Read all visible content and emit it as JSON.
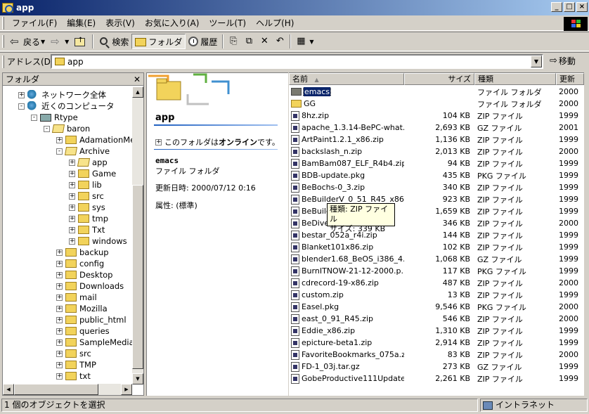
{
  "window": {
    "title": "app"
  },
  "menu": [
    "ファイル(F)",
    "編集(E)",
    "表示(V)",
    "お気に入り(A)",
    "ツール(T)",
    "ヘルプ(H)"
  ],
  "toolbar": {
    "back": "戻る",
    "search": "検索",
    "folders": "フォルダ",
    "history": "履歴"
  },
  "address": {
    "label": "アドレス(D)",
    "value": "app",
    "go": "移動"
  },
  "folder_pane": {
    "title": "フォルダ",
    "tree": [
      {
        "label": "ネットワーク全体",
        "depth": 1,
        "icon": "network-icon",
        "exp": "+"
      },
      {
        "label": "近くのコンピュータ",
        "depth": 1,
        "icon": "network-icon",
        "exp": "-"
      },
      {
        "label": "Rtype",
        "depth": 2,
        "icon": "computer-icon",
        "exp": "-"
      },
      {
        "label": "baron",
        "depth": 3,
        "icon": "folder-open-icon",
        "exp": "-"
      },
      {
        "label": "AdamationMe",
        "depth": 4,
        "icon": "folder-icon",
        "exp": "+"
      },
      {
        "label": "Archive",
        "depth": 4,
        "icon": "folder-open-icon",
        "exp": "-"
      },
      {
        "label": "app",
        "depth": 5,
        "icon": "folder-open-icon",
        "exp": "+"
      },
      {
        "label": "Game",
        "depth": 5,
        "icon": "folder-icon",
        "exp": "+"
      },
      {
        "label": "lib",
        "depth": 5,
        "icon": "folder-icon",
        "exp": "+"
      },
      {
        "label": "src",
        "depth": 5,
        "icon": "folder-icon",
        "exp": "+"
      },
      {
        "label": "sys",
        "depth": 5,
        "icon": "folder-icon",
        "exp": "+"
      },
      {
        "label": "tmp",
        "depth": 5,
        "icon": "folder-icon",
        "exp": "+"
      },
      {
        "label": "Txt",
        "depth": 5,
        "icon": "folder-icon",
        "exp": "+"
      },
      {
        "label": "windows",
        "depth": 5,
        "icon": "folder-icon",
        "exp": "+"
      },
      {
        "label": "backup",
        "depth": 4,
        "icon": "folder-icon",
        "exp": "+"
      },
      {
        "label": "config",
        "depth": 4,
        "icon": "folder-icon",
        "exp": "+"
      },
      {
        "label": "Desktop",
        "depth": 4,
        "icon": "folder-icon",
        "exp": "+"
      },
      {
        "label": "Downloads",
        "depth": 4,
        "icon": "folder-icon",
        "exp": "+"
      },
      {
        "label": "mail",
        "depth": 4,
        "icon": "folder-icon",
        "exp": "+"
      },
      {
        "label": "Mozilla",
        "depth": 4,
        "icon": "folder-icon",
        "exp": "+"
      },
      {
        "label": "public_html",
        "depth": 4,
        "icon": "folder-icon",
        "exp": "+"
      },
      {
        "label": "queries",
        "depth": 4,
        "icon": "folder-icon",
        "exp": "+"
      },
      {
        "label": "SampleMedia",
        "depth": 4,
        "icon": "folder-icon",
        "exp": "+"
      },
      {
        "label": "src",
        "depth": 4,
        "icon": "folder-icon",
        "exp": "+"
      },
      {
        "label": "TMP",
        "depth": 4,
        "icon": "folder-icon",
        "exp": "+"
      },
      {
        "label": "txt",
        "depth": 4,
        "icon": "folder-icon",
        "exp": "+"
      }
    ]
  },
  "webview": {
    "folder_name": "app",
    "online_pre": "このフォルダは",
    "online_bold": "オンライン",
    "online_post": "です。",
    "item_name": "emacs",
    "item_type": "ファイル フォルダ",
    "modified": "更新日時: 2000/07/12 0:16",
    "attributes": "属性: (標準)"
  },
  "list": {
    "columns": {
      "name": "名前",
      "size": "サイズ",
      "type": "種類",
      "modified": "更新"
    },
    "rows": [
      {
        "name": "emacs",
        "size": "",
        "type": "ファイル フォルダ",
        "mod": "2000",
        "kind": "folder-dark",
        "selected": true
      },
      {
        "name": "GG",
        "size": "",
        "type": "ファイル フォルダ",
        "mod": "2000",
        "kind": "folder"
      },
      {
        "name": "8hz.zip",
        "size": "104 KB",
        "type": "ZIP ファイル",
        "mod": "1999",
        "kind": "file"
      },
      {
        "name": "apache_1.3.14-BePC-what...",
        "size": "2,693 KB",
        "type": "GZ ファイル",
        "mod": "2001",
        "kind": "file"
      },
      {
        "name": "ArtPaint1.2.1_x86.zip",
        "size": "1,136 KB",
        "type": "ZIP ファイル",
        "mod": "1999",
        "kind": "file"
      },
      {
        "name": "backslash_n.zip",
        "size": "2,013 KB",
        "type": "ZIP ファイル",
        "mod": "2000",
        "kind": "file"
      },
      {
        "name": "BamBam087_ELF_R4b4.zip",
        "size": "94 KB",
        "type": "ZIP ファイル",
        "mod": "1999",
        "kind": "file"
      },
      {
        "name": "BDB-update.pkg",
        "size": "435 KB",
        "type": "PKG ファイル",
        "mod": "1999",
        "kind": "file"
      },
      {
        "name": "BeBochs-0_3.zip",
        "size": "340 KB",
        "type": "ZIP ファイル",
        "mod": "1999",
        "kind": "file"
      },
      {
        "name": "BeBuilderV_0_51_R45_x86.z...",
        "size": "923 KB",
        "type": "ZIP ファイル",
        "mod": "1999",
        "kind": "file"
      },
      {
        "name": "BeBuilder_0_4.tar.zip",
        "size": "1,659 KB",
        "type": "ZIP ファイル",
        "mod": "1999",
        "kind": "file"
      },
      {
        "name": "BeDiver.zip",
        "size": "346 KB",
        "type": "ZIP ファイル",
        "mod": "2000",
        "kind": "file"
      },
      {
        "name": "bestar_052a_r4i.zip",
        "size": "144 KB",
        "type": "ZIP ファイル",
        "mod": "1999",
        "kind": "file"
      },
      {
        "name": "Blanket101x86.zip",
        "size": "102 KB",
        "type": "ZIP ファイル",
        "mod": "1999",
        "kind": "file"
      },
      {
        "name": "blender1.68_BeOS_i386_4.5...",
        "size": "1,068 KB",
        "type": "GZ ファイル",
        "mod": "1999",
        "kind": "file"
      },
      {
        "name": "BurnITNOW-21-12-2000.p...",
        "size": "117 KB",
        "type": "PKG ファイル",
        "mod": "1999",
        "kind": "file"
      },
      {
        "name": "cdrecord-19-x86.zip",
        "size": "487 KB",
        "type": "ZIP ファイル",
        "mod": "2000",
        "kind": "file"
      },
      {
        "name": "custom.zip",
        "size": "13 KB",
        "type": "ZIP ファイル",
        "mod": "1999",
        "kind": "file"
      },
      {
        "name": "Easel.pkg",
        "size": "9,546 KB",
        "type": "PKG ファイル",
        "mod": "2000",
        "kind": "file"
      },
      {
        "name": "east_0_91_R45.zip",
        "size": "546 KB",
        "type": "ZIP ファイル",
        "mod": "2000",
        "kind": "file"
      },
      {
        "name": "Eddie_x86.zip",
        "size": "1,310 KB",
        "type": "ZIP ファイル",
        "mod": "1999",
        "kind": "file"
      },
      {
        "name": "epicture-beta1.zip",
        "size": "2,914 KB",
        "type": "ZIP ファイル",
        "mod": "1999",
        "kind": "file"
      },
      {
        "name": "FavoriteBookmarks_075a.zip",
        "size": "83 KB",
        "type": "ZIP ファイル",
        "mod": "2000",
        "kind": "file"
      },
      {
        "name": "FD-1_03j.tar.gz",
        "size": "273 KB",
        "type": "GZ ファイル",
        "mod": "1999",
        "kind": "file"
      },
      {
        "name": "GobeProductive111Update...",
        "size": "2,261 KB",
        "type": "ZIP ファイル",
        "mod": "1999",
        "kind": "file"
      }
    ]
  },
  "tooltip": {
    "line1": "種類: ZIP ファイル",
    "line2": "サイズ: 339 KB"
  },
  "status": {
    "text": "1 個のオブジェクトを選択",
    "zone": "イントラネット"
  }
}
